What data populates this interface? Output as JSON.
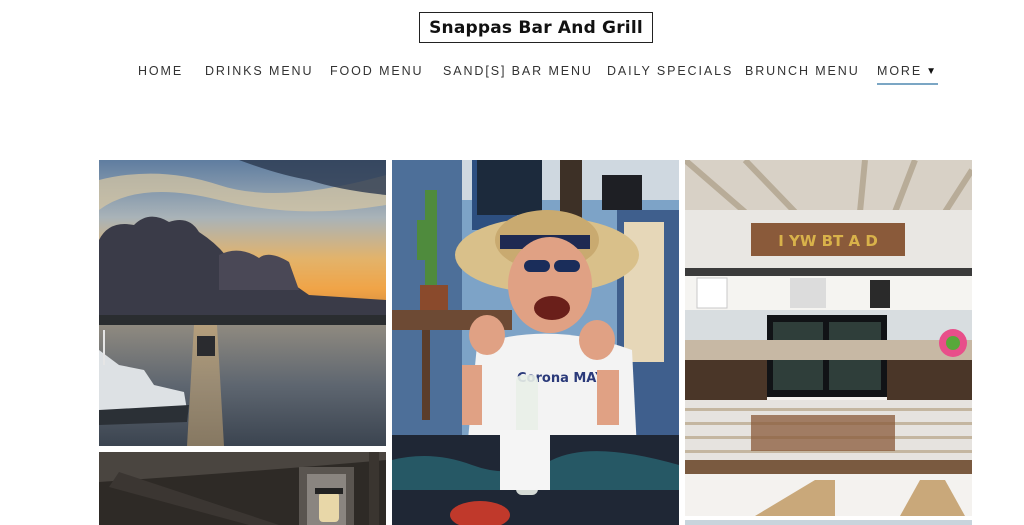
{
  "site": {
    "title": "Snappas Bar And Grill"
  },
  "nav": {
    "items": [
      {
        "label": "HOME"
      },
      {
        "label": "DRINKS MENU"
      },
      {
        "label": "FOOD MENU"
      },
      {
        "label": "SAND[S] BAR MENU"
      },
      {
        "label": "DAILY SPECIALS"
      },
      {
        "label": "BRUNCH MENU"
      }
    ],
    "more_label": "MORE",
    "active_color": "#7ba6c4"
  },
  "gallery": {
    "bar_sign_text": "I   YW   BT   A D",
    "shirt_text": "Corona MAYO"
  }
}
